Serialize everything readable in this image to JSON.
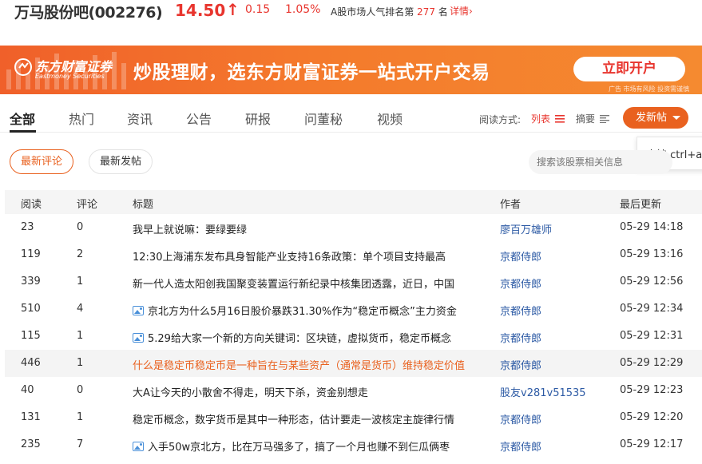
{
  "stock": {
    "name": "万马股份吧(002276)",
    "price": "14.50",
    "arrow": "↑",
    "change": "0.15",
    "change_pct": "1.05%",
    "rank_prefix": "A股市场人气排名第",
    "rank_value": "277",
    "rank_suffix": "名",
    "detail_label": "详情"
  },
  "banner": {
    "logo_cn": "东方财富证券",
    "logo_en": "Eastmoney Securities",
    "slogan": "炒股理财，选东方财富证券一站式开户交易",
    "cta_label": "立即开户",
    "disclaimer": "广告 市场有风险 投资需谨慎"
  },
  "tabs": [
    {
      "label": "全部",
      "active": true
    },
    {
      "label": "热门"
    },
    {
      "label": "资讯"
    },
    {
      "label": "公告"
    },
    {
      "label": "研报"
    },
    {
      "label": "问董秘"
    },
    {
      "label": "视频"
    }
  ],
  "read_mode": {
    "label": "阅读方式:",
    "list_label": "列表",
    "summary_label": "摘要"
  },
  "post_button_label": "发新帖",
  "tooltip_text": "支持 ctrl+alt",
  "filters": {
    "latest_comment": "最新评论",
    "latest_post": "最新发帖"
  },
  "search": {
    "placeholder": "搜索该股票相关信息"
  },
  "table": {
    "headers": {
      "read": "阅读",
      "comment": "评论",
      "title": "标题",
      "author": "作者",
      "updated": "最后更新"
    },
    "rows": [
      {
        "read": "23",
        "comment": "0",
        "title": "我早上就说嘛：要绿要绿",
        "author": "廖百万雄师",
        "time": "05-29 14:18",
        "image": false,
        "highlight": false
      },
      {
        "read": "119",
        "comment": "2",
        "title": "12:30上海浦东发布具身智能产业支持16条政策：单个项目支持最高",
        "author": "京都侍郎",
        "time": "05-29 13:16",
        "image": false,
        "highlight": false
      },
      {
        "read": "339",
        "comment": "1",
        "title": "新一代人造太阳创我国聚变装置运行新纪录中核集团透露，近日，中国",
        "author": "京都侍郎",
        "time": "05-29 12:56",
        "image": false,
        "highlight": false
      },
      {
        "read": "510",
        "comment": "4",
        "title": "京北方为什么5月16日股价暴跌31.30%作为“稳定币概念”主力资金",
        "author": "京都侍郎",
        "time": "05-29 12:34",
        "image": true,
        "highlight": false
      },
      {
        "read": "115",
        "comment": "1",
        "title": "5.29给大家一个新的方向关键词：区块链，虚拟货币，稳定币概念",
        "author": "京都侍郎",
        "time": "05-29 12:31",
        "image": true,
        "highlight": false
      },
      {
        "read": "446",
        "comment": "1",
        "title": "什么是稳定币稳定币是一种旨在与某些资产（通常是货币）维持稳定价值",
        "author": "京都侍郎",
        "time": "05-29 12:29",
        "image": false,
        "highlight": true
      },
      {
        "read": "40",
        "comment": "0",
        "title": "大A让今天的小散舍不得走，明天下杀，资金别想走",
        "author": "股友v281v51535",
        "time": "05-29 12:23",
        "image": false,
        "highlight": false
      },
      {
        "read": "131",
        "comment": "1",
        "title": "稳定币概念，数字货币是其中一种形态，估计要走一波核定主旋律行情",
        "author": "京都侍郎",
        "time": "05-29 12:20",
        "image": false,
        "highlight": false
      },
      {
        "read": "235",
        "comment": "7",
        "title": "入手50w京北方，比在万马强多了，搞了一个月也赚不到仨瓜俩枣",
        "author": "京都侍郎",
        "time": "05-29 12:17",
        "image": true,
        "highlight": false
      }
    ]
  },
  "colors": {
    "accent": "#e9611f",
    "up": "#e8352e",
    "author_link": "#2b59a4"
  }
}
